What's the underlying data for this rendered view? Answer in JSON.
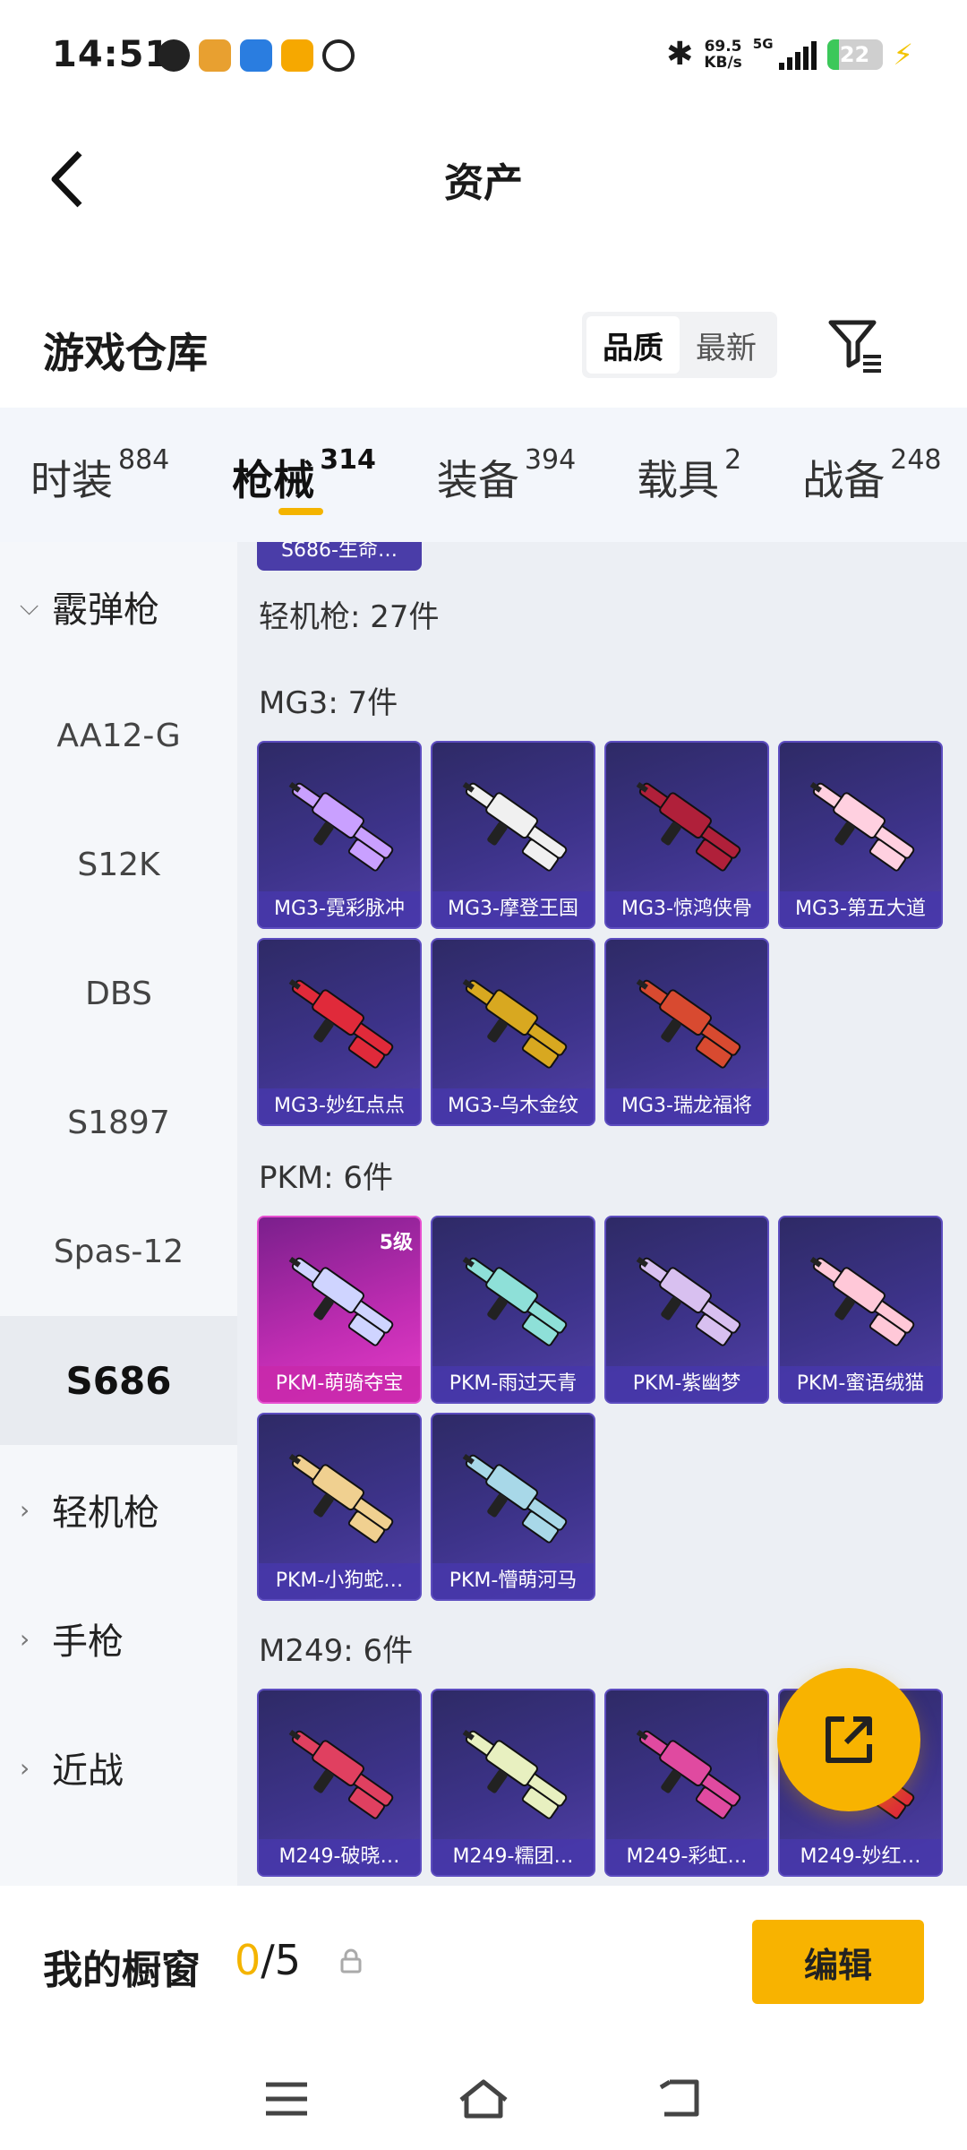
{
  "status_bar": {
    "time": "14:51",
    "net_speed_value": "69.5",
    "net_speed_unit": "KB/s",
    "network": "5G",
    "battery": "22"
  },
  "title_bar": {
    "title": "资产"
  },
  "warehouse": {
    "title": "游戏仓库",
    "sort_options": [
      "品质",
      "最新"
    ],
    "active_sort": "品质"
  },
  "tabs": [
    {
      "label": "时装",
      "count": "884"
    },
    {
      "label": "枪械",
      "count": "314",
      "active": true
    },
    {
      "label": "装备",
      "count": "394"
    },
    {
      "label": "载具",
      "count": "2"
    },
    {
      "label": "战备",
      "count": "248"
    }
  ],
  "sidebar": {
    "items": [
      {
        "label": "霰弹枪",
        "type": "parent"
      },
      {
        "label": "AA12-G"
      },
      {
        "label": "S12K"
      },
      {
        "label": "DBS"
      },
      {
        "label": "S1897"
      },
      {
        "label": "Spas-12"
      },
      {
        "label": "S686",
        "active": true
      },
      {
        "label": "轻机枪",
        "type": "parent"
      },
      {
        "label": "手枪",
        "type": "parent"
      },
      {
        "label": "近战",
        "type": "parent"
      }
    ]
  },
  "content": {
    "prev_chip": "S686-生命…",
    "category_header": "轻机枪: 27件",
    "groups": [
      {
        "header": "MG3: 7件",
        "items": [
          {
            "name": "MG3-霓彩脉冲",
            "color": "#c9a0ff"
          },
          {
            "name": "MG3-摩登王国",
            "color": "#f0f0f0"
          },
          {
            "name": "MG3-惊鸿侠骨",
            "color": "#b0203a"
          },
          {
            "name": "MG3-第五大道",
            "color": "#ffd0e0"
          },
          {
            "name": "MG3-妙红点点",
            "color": "#e02a3a"
          },
          {
            "name": "MG3-乌木金纹",
            "color": "#d8a820"
          },
          {
            "name": "MG3-瑞龙福将",
            "color": "#d84a30"
          }
        ]
      },
      {
        "header": "PKM: 6件",
        "items": [
          {
            "name": "PKM-萌骑夺宝",
            "color": "#cfd4ff",
            "badge": "5级",
            "highlight": true
          },
          {
            "name": "PKM-雨过天青",
            "color": "#8ee0d8"
          },
          {
            "name": "PKM-紫幽梦",
            "color": "#d8c0f0"
          },
          {
            "name": "PKM-蜜语绒猫",
            "color": "#ffc8d8"
          },
          {
            "name": "PKM-小狗蛇…",
            "color": "#f0d090"
          },
          {
            "name": "PKM-懵萌河马",
            "color": "#a8d8e8"
          }
        ]
      },
      {
        "header": "M249: 6件",
        "items": [
          {
            "name": "M249-破晓…",
            "color": "#e04060"
          },
          {
            "name": "M249-糯团…",
            "color": "#e8f0c0"
          },
          {
            "name": "M249-彩虹…",
            "color": "#e04aa0"
          },
          {
            "name": "M249-妙红…",
            "color": "#e02a3a"
          }
        ]
      }
    ]
  },
  "showcase": {
    "title": "我的橱窗",
    "current": "0",
    "total": "/5",
    "edit_label": "编辑"
  }
}
